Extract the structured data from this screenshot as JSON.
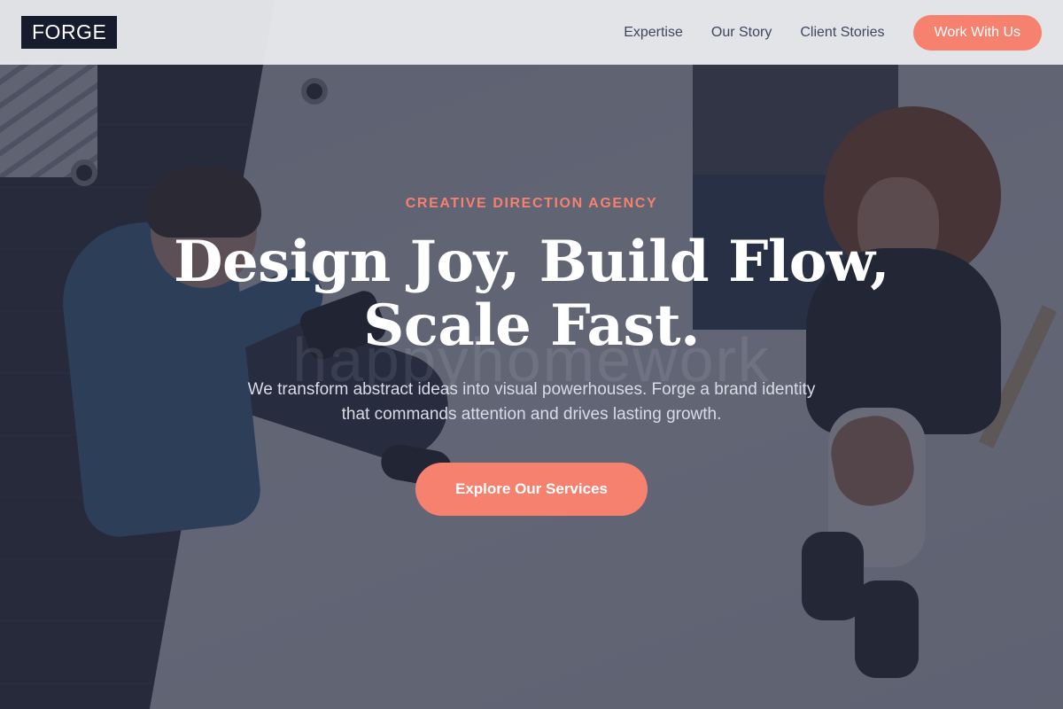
{
  "header": {
    "logo": "FORGE",
    "nav": [
      {
        "label": "Expertise"
      },
      {
        "label": "Our Story"
      },
      {
        "label": "Client Stories"
      }
    ],
    "cta_label": "Work With Us"
  },
  "hero": {
    "eyebrow": "CREATIVE DIRECTION AGENCY",
    "headline_line1": "Design Joy, Build Flow,",
    "headline_line2": "Scale Fast.",
    "subtitle": "We transform abstract ideas into visual powerhouses. Forge a brand identity that commands attention and drives lasting growth.",
    "cta_label": "Explore Our Services",
    "watermark": "happyhomework"
  },
  "colors": {
    "accent": "#f7816f",
    "logo_bg": "#161b2e",
    "overlay": "#24293d",
    "nav_text": "#3f4660"
  }
}
